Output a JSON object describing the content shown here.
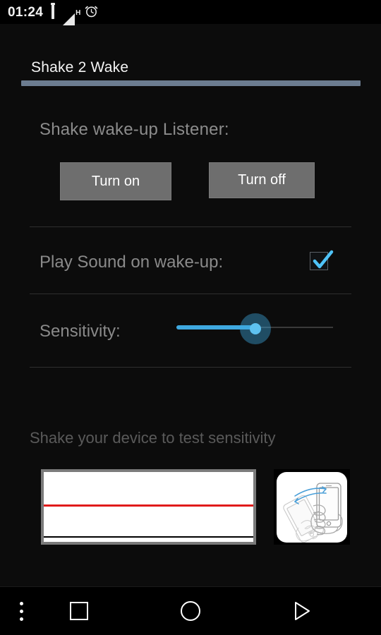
{
  "status_bar": {
    "clock": "01:24",
    "icons": [
      {
        "name": "battery-icon",
        "label": "battery"
      },
      {
        "name": "signal-icon",
        "label": "H"
      },
      {
        "name": "alarm-clock-icon",
        "label": "alarm"
      }
    ],
    "network_type": "H"
  },
  "app": {
    "title": "Shake 2 Wake",
    "accent_bar_color": "#6c7c90"
  },
  "listener_section": {
    "label": "Shake wake-up Listener:",
    "turn_on_label": "Turn on",
    "turn_off_label": "Turn off",
    "button_color": "#6e6e6e"
  },
  "play_sound_section": {
    "label": "Play Sound on wake-up:",
    "checked": true,
    "check_color": "#4fc3f7"
  },
  "sensitivity_section": {
    "label": "Sensitivity:",
    "value_percent": 51,
    "fill_color": "#3fa9e0",
    "thumb_color": "#5ec2f0"
  },
  "test_section": {
    "hint": "Shake your device to test sensitivity",
    "graph": {
      "threshold_line_color": "#e01b1b",
      "baseline_color": "#000000",
      "background": "#ffffff",
      "frame_color": "#7b7b7b"
    },
    "illustration": {
      "name": "shake-phone-illustration",
      "motion_arrow_color": "#4a9fd8"
    }
  },
  "nav_bar": {
    "overflow_label": "More options",
    "recents_label": "Recents",
    "home_label": "Home",
    "back_label": "Back"
  }
}
